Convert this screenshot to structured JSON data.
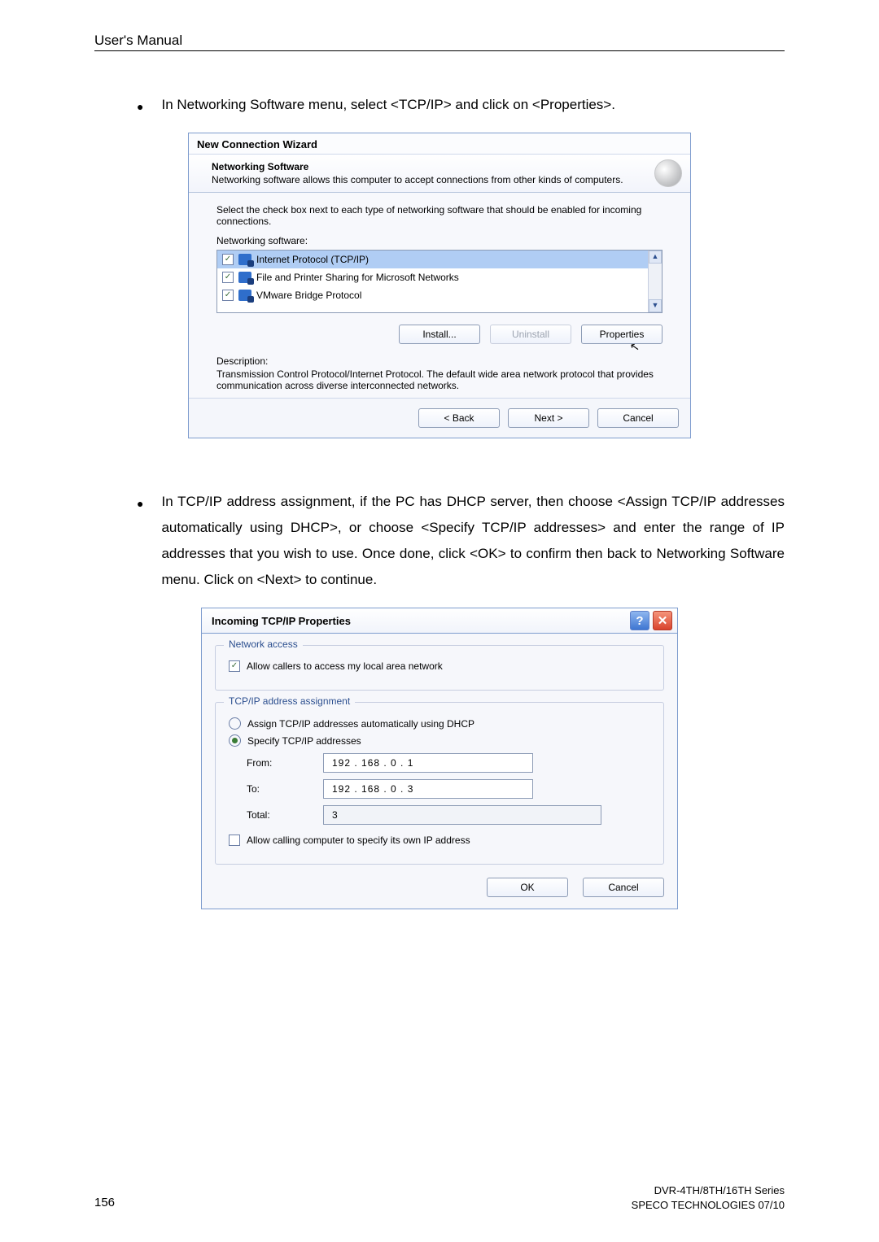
{
  "header": "User's Manual",
  "bullets": {
    "b1": "In Networking Software menu, select <TCP/IP> and click on <Properties>.",
    "b2": "In TCP/IP address assignment, if the PC has DHCP server, then choose <Assign TCP/IP addresses automatically using DHCP>, or choose <Specify TCP/IP addresses> and enter the range of IP addresses that you wish to use.    Once done, click <OK> to confirm then back to Networking Software menu. Click on <Next> to continue."
  },
  "wizard": {
    "title": "New Connection Wizard",
    "sub_title": "Networking Software",
    "sub_desc": "Networking software allows this computer to accept connections from other kinds of computers.",
    "instr": "Select the check box next to each type of networking software that should be enabled for incoming connections.",
    "sw_label": "Networking software:",
    "items": {
      "i0": "Internet Protocol (TCP/IP)",
      "i1": "File and Printer Sharing for Microsoft Networks",
      "i2": "VMware Bridge Protocol"
    },
    "install": "Install...",
    "uninstall": "Uninstall",
    "properties": "Properties",
    "desc_label": "Description:",
    "desc": "Transmission Control Protocol/Internet Protocol. The default wide area network protocol that provides communication across diverse interconnected networks.",
    "back": "< Back",
    "next": "Next >",
    "cancel": "Cancel"
  },
  "props": {
    "title": "Incoming TCP/IP Properties",
    "na_legend": "Network access",
    "na_chk": "Allow callers to access my local area network",
    "aa_legend": "TCP/IP address assignment",
    "aa_dhcp": "Assign TCP/IP addresses automatically using DHCP",
    "aa_spec": "Specify TCP/IP addresses",
    "from_lbl": "From:",
    "to_lbl": "To:",
    "total_lbl": "Total:",
    "from_val": "192  .  168  .    0   .    1",
    "to_val": "192  .  168  .    0   .    3",
    "total_val": "3",
    "allow_own": "Allow calling computer to specify its own IP address",
    "ok": "OK",
    "cancel": "Cancel"
  },
  "footer": {
    "page": "156",
    "r1": "DVR-4TH/8TH/16TH Series",
    "r2": "SPECO TECHNOLOGIES 07/10"
  }
}
